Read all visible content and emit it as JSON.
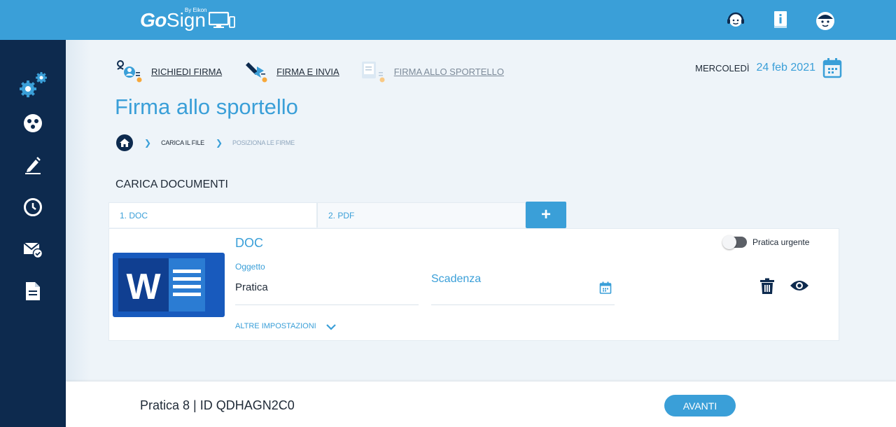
{
  "header": {
    "logo_go": "Go",
    "logo_sign": "Sign",
    "logo_by": "By Eikon"
  },
  "actions": {
    "request_sign": "RICHIEDI FIRMA",
    "sign_send": "FIRMA E INVIA",
    "counter_sign": "FIRMA ALLO SPORTELLO"
  },
  "date": {
    "day": "MERCOLEDÌ",
    "value": "24 feb 2021"
  },
  "page": {
    "title": "Firma allo sportello"
  },
  "breadcrumb": {
    "step1": "CARICA IL FILE",
    "step2": "POSIZIONA LE FIRME"
  },
  "section": {
    "title": "CARICA DOCUMENTI"
  },
  "tabs": [
    {
      "label": "1. DOC"
    },
    {
      "label": "2. PDF"
    }
  ],
  "add_tab_symbol": "+",
  "document": {
    "title": "DOC",
    "subject_label": "Oggetto",
    "subject_value": "Pratica",
    "deadline_label": "Scadenza",
    "more_settings": "ALTRE IMPOSTAZIONI",
    "urgent_label": "Pratica urgente",
    "urgent_on": false,
    "thumb_letter": "W"
  },
  "footer": {
    "info": "Pratica 8 | ID QDHAGN2C0",
    "next_label": "AVANTI"
  },
  "icons": {
    "top": [
      "support-agent-icon",
      "info-book-icon",
      "user-avatar-icon"
    ],
    "sidebar": [
      "settings-gears-icon",
      "dashboard-palette-icon",
      "sign-pen-icon",
      "history-clock-icon",
      "mail-check-icon",
      "document-icon"
    ]
  },
  "colors": {
    "brand_blue": "#3a9fd8",
    "sidebar_navy": "#0d2a4e",
    "background": "#eef4f9",
    "word_blue": "#185abd"
  }
}
